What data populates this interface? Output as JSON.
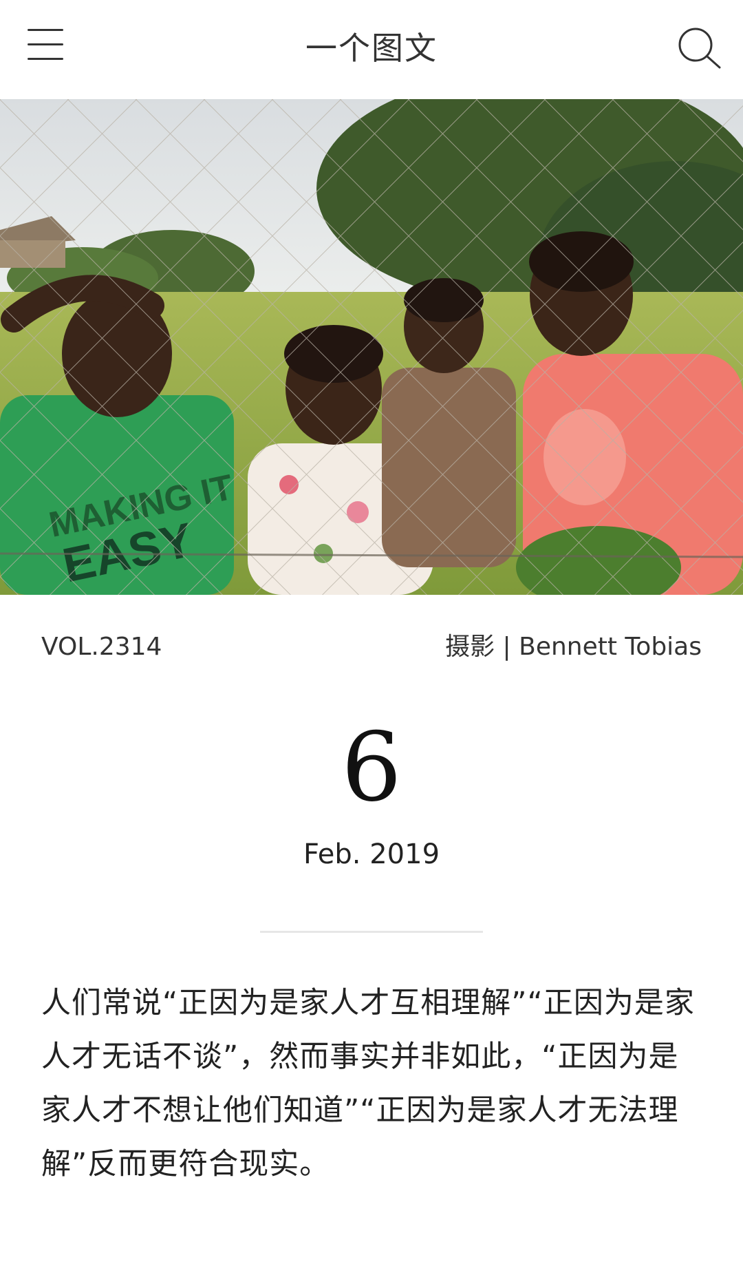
{
  "header": {
    "title": "一个图文",
    "menu_icon": "hamburger-menu-icon",
    "search_icon": "search-icon"
  },
  "hero": {
    "image": "photo-of-four-children-behind-chain-link-fence"
  },
  "meta": {
    "volume": "VOL.2314",
    "credit": "摄影 | Bennett Tobias"
  },
  "date": {
    "day": "6",
    "month_year": "Feb. 2019"
  },
  "quote": {
    "text": "人们常说“正因为是家人才互相理解”“正因为是家人才无话不谈”，然而事实并非如此，“正因为是家人才不想让他们知道”“正因为是家人才无法理解”反而更符合现实。"
  }
}
